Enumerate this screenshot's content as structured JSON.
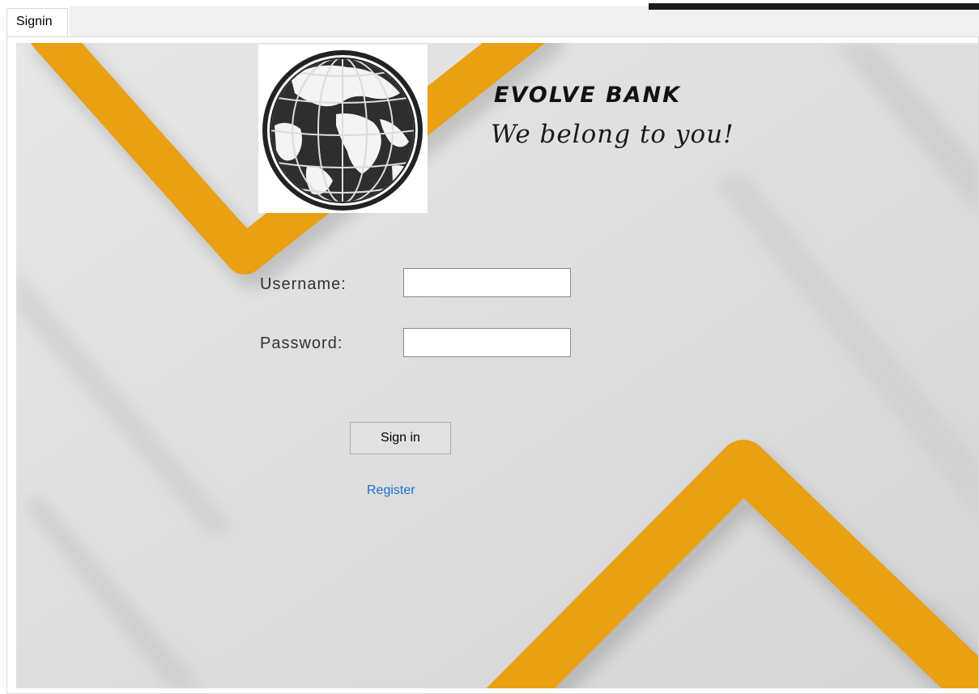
{
  "tabs": [
    {
      "label": "Signin",
      "active": true
    }
  ],
  "branding": {
    "logo_icon": "globe-icon",
    "bank_name": "EVOLVE BANK",
    "tagline": "We belong to you!"
  },
  "form": {
    "username_label": "Username:",
    "username_value": "",
    "password_label": "Password:",
    "password_value": "",
    "signin_label": "Sign in",
    "register_label": "Register"
  },
  "colors": {
    "accent": "#e9a012",
    "background": "#dcdcdc",
    "link": "#1e6fcf"
  }
}
